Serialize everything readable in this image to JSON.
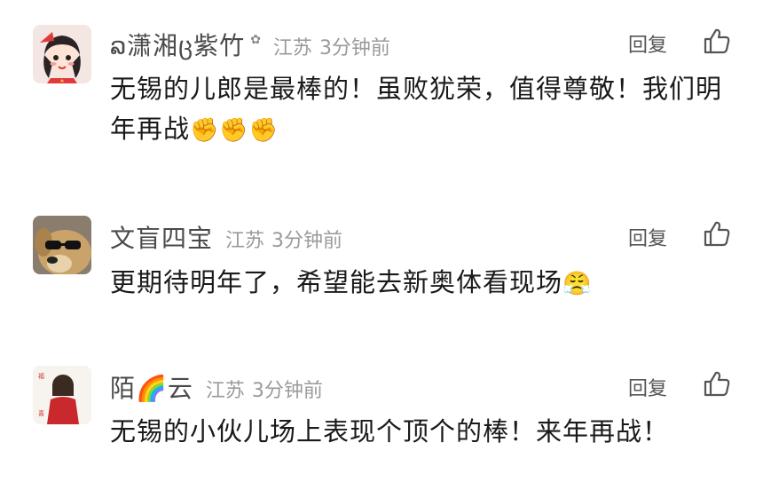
{
  "comments": [
    {
      "username": "ລ潇湘ც紫竹",
      "badge": "✿",
      "location": "江苏",
      "time": "3分钟前",
      "reply_label": "回复",
      "text": "无锡的儿郎是最棒的！虽败犹荣，值得尊敬！我们明年再战",
      "emojis": [
        "✊",
        "✊",
        "✊"
      ],
      "avatar": "girl-avatar"
    },
    {
      "username": "文盲四宝",
      "location": "江苏",
      "time": "3分钟前",
      "reply_label": "回复",
      "text": "更期待明年了，希望能去新奥体看现场",
      "emojis": [
        "😤"
      ],
      "avatar": "dog-sunglasses-avatar"
    },
    {
      "username": "陌",
      "username_emoji": "🌈",
      "username_suffix": "云",
      "location": "江苏",
      "time": "3分钟前",
      "reply_label": "回复",
      "text": "无锡的小伙儿场上表现个顶个的棒！来年再战！",
      "avatar": "girl-red-dress-avatar"
    }
  ],
  "colors": {
    "username": "#4a4a4a",
    "meta": "#9a9a9a",
    "text": "#1a1a1a",
    "reply": "#555555"
  }
}
